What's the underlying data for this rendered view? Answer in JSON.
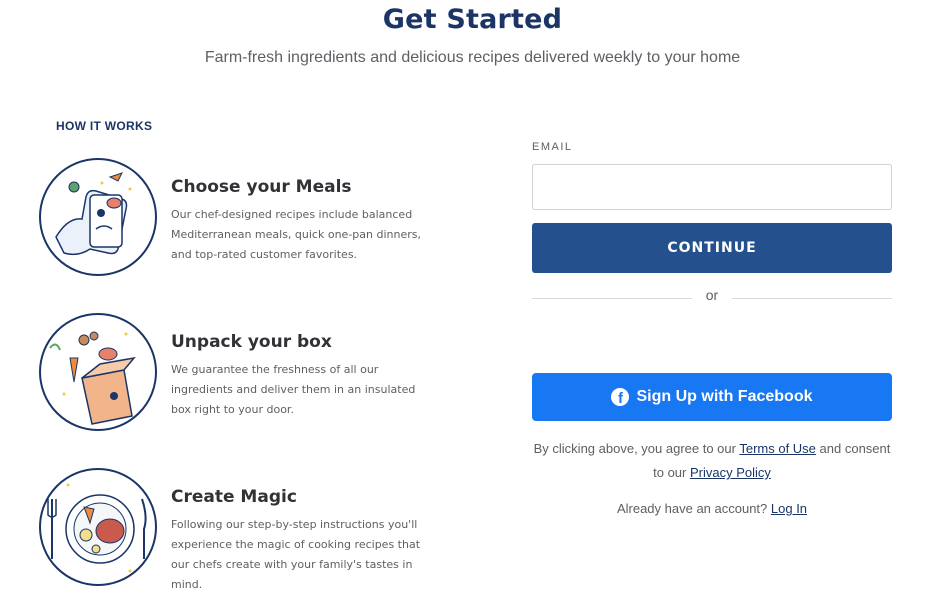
{
  "header": {
    "title": "Get Started",
    "subtitle": "Farm-fresh ingredients and delicious recipes delivered weekly to your home"
  },
  "how_it_works": {
    "heading": "HOW IT WORKS",
    "steps": [
      {
        "title": "Choose your Meals",
        "description": "Our chef-designed recipes include balanced Mediterranean meals, quick one-pan dinners, and top-rated customer favorites.",
        "icon": "phone-meals-illustration"
      },
      {
        "title": "Unpack your box",
        "description": "We guarantee the freshness of all our ingredients and deliver them in an insulated box right to your door.",
        "icon": "delivery-box-illustration"
      },
      {
        "title": "Create Magic",
        "description": "Following our step-by-step instructions you'll experience the magic of cooking recipes that our chefs create with your family's tastes in mind.",
        "icon": "plated-meal-illustration"
      }
    ]
  },
  "signup": {
    "email_label": "EMAIL",
    "email_value": "",
    "email_placeholder": "",
    "continue_label": "CONTINUE",
    "divider_text": "or",
    "facebook_label": "Sign Up with Facebook",
    "legal_prefix": "By clicking above, you agree to our ",
    "terms_label": "Terms of Use",
    "legal_middle": " and consent to our ",
    "privacy_label": "Privacy Policy",
    "account_prefix": "Already have an account? ",
    "login_label": "Log In"
  },
  "colors": {
    "brand_navy": "#1b3567",
    "continue_button": "#24508e",
    "facebook_blue": "#1877f2",
    "body_text": "#5d6064"
  }
}
